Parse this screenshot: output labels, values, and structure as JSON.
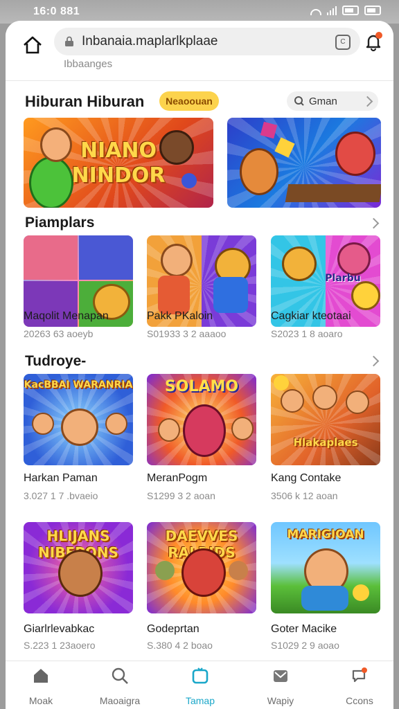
{
  "status": {
    "time": "16:0 881"
  },
  "browser": {
    "url": "Inbanaia.maplarlkplaae",
    "subtitle": "Ibbaanges",
    "tab_count": "C"
  },
  "featured": {
    "title": "Hiburan Hiburan",
    "badge": "Neaoouan",
    "see_all": "Gman",
    "banners": [
      {
        "logo": "NIANO\nNINDOR"
      },
      {
        "logo": ""
      }
    ]
  },
  "sections": [
    {
      "title": "Piamplars",
      "games": [
        {
          "title": "Maqolit Menapan",
          "meta": "20263 63 aoeyb",
          "logo": ""
        },
        {
          "title": "Pakk PKaloin",
          "meta": "S01933 3 2 aaaoo",
          "logo": ""
        },
        {
          "title": "Cagkiar kteotaai",
          "meta": "S2023 1 8 aoaro",
          "logo": "Plarbu"
        }
      ]
    },
    {
      "title": "Tudroye-",
      "games": [
        {
          "title": "Harkan Paman",
          "meta": "3.027 1 7 .bvaeio",
          "logo": "KacBBAI WARANRIA"
        },
        {
          "title": "MeranPogm",
          "meta": "S1299 3 2 aoan",
          "logo": "SOLAMO"
        },
        {
          "title": "Kang Contake",
          "meta": "3506 k 12 aoan",
          "logo": "Hlakaplaes"
        }
      ]
    },
    {
      "title": "",
      "games": [
        {
          "title": "Giarlrlevabkac",
          "meta": "S.223 1 23aoero",
          "logo": "HLIJANS NIBEPONS"
        },
        {
          "title": "Godeprtan",
          "meta": "S.380 4 2 boao",
          "logo": "DAEVVES RALRIDS"
        },
        {
          "title": "Goter Macike",
          "meta": "S1029 2 9 aoao",
          "logo": "MARIGIOAN"
        }
      ]
    }
  ],
  "nav": [
    {
      "label": "Moak",
      "icon": "home-icon"
    },
    {
      "label": "Maoaigra",
      "icon": "search-icon"
    },
    {
      "label": "Tamap",
      "icon": "game-icon",
      "active": true
    },
    {
      "label": "Wapiy",
      "icon": "inbox-icon"
    },
    {
      "label": "Ccons",
      "icon": "chat-icon"
    }
  ],
  "colors": {
    "accent": "#1aa7c9",
    "badge": "#fcd34d",
    "notification": "#f05a28"
  }
}
